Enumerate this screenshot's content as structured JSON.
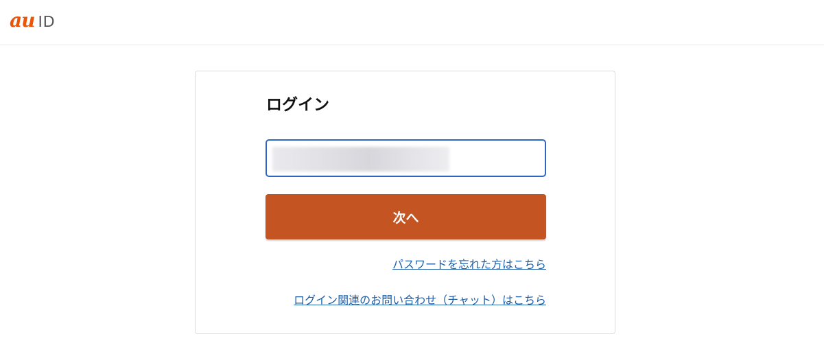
{
  "header": {
    "logo_au": "au",
    "logo_id": "ID"
  },
  "login": {
    "title": "ログイン",
    "id_input": {
      "value": "",
      "placeholder": ""
    },
    "next_label": "次へ",
    "forgot_password_link": "パスワードを忘れた方はこちら",
    "chat_inquiry_link": "ログイン関連のお問い合わせ（チャット）はこちら"
  },
  "colors": {
    "brand": "#eb5505",
    "primary_button": "#c45523",
    "input_focus_border": "#2f66c2",
    "link": "#1f5fa8"
  }
}
